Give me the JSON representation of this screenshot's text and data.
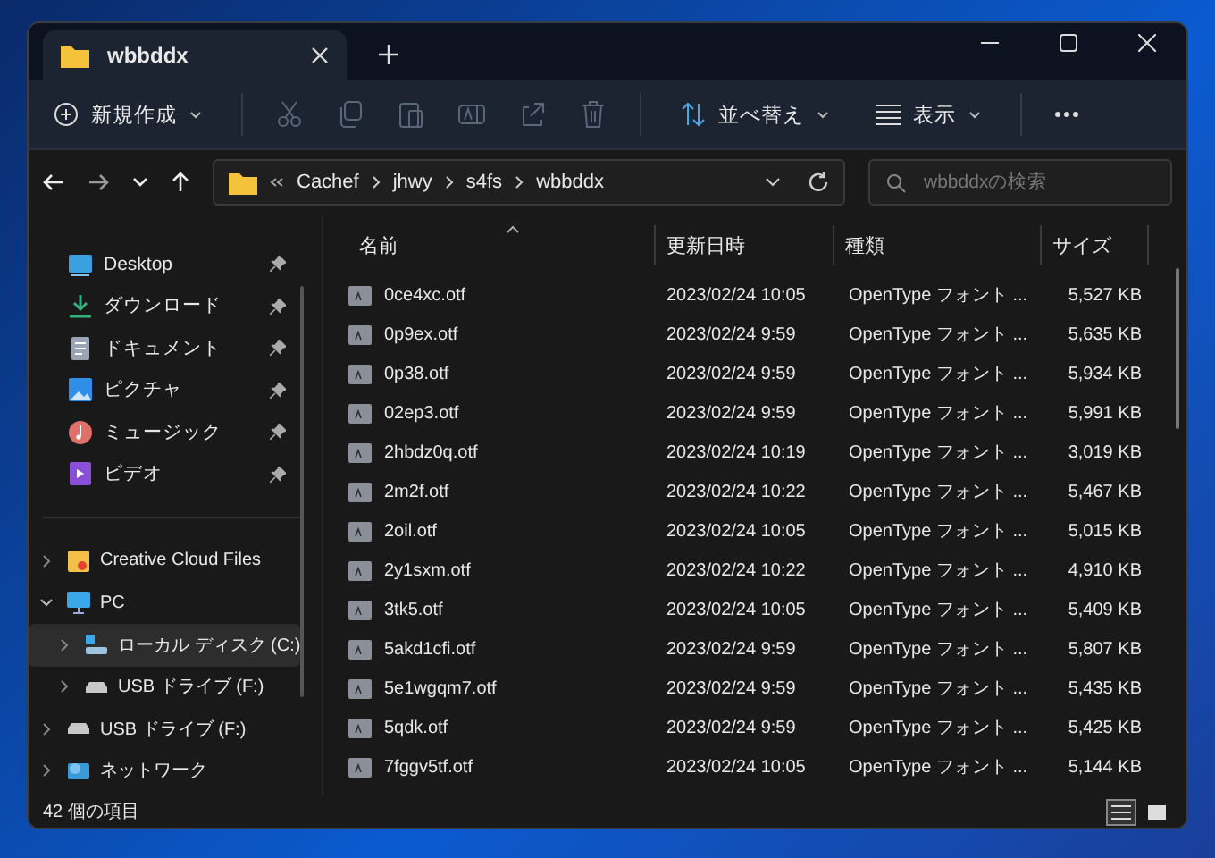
{
  "tab": {
    "title": "wbbddx",
    "selected": true
  },
  "toolbar": {
    "new_label": "新規作成",
    "sort_label": "並べ替え",
    "view_label": "表示"
  },
  "address": {
    "segments": [
      "Cachef",
      "jhwy",
      "s4fs",
      "wbbddx"
    ],
    "search_placeholder": "wbbddxの検索"
  },
  "sidebar": {
    "quick_access": [
      {
        "label": "Desktop",
        "kind": "desktop",
        "pinned": true
      },
      {
        "label": "ダウンロード",
        "kind": "download",
        "pinned": true
      },
      {
        "label": "ドキュメント",
        "kind": "document",
        "pinned": true
      },
      {
        "label": "ピクチャ",
        "kind": "picture",
        "pinned": true
      },
      {
        "label": "ミュージック",
        "kind": "music",
        "pinned": true
      },
      {
        "label": "ビデオ",
        "kind": "video",
        "pinned": true
      }
    ],
    "tree": [
      {
        "label": "Creative Cloud Files",
        "kind": "cloud",
        "expanded": false,
        "selected": false
      },
      {
        "label": "PC",
        "kind": "pc",
        "expanded": true,
        "selected": false,
        "children": [
          {
            "label": "ローカル ディスク (C:)",
            "kind": "disk",
            "expanded": false,
            "selected": true
          },
          {
            "label": "USB ドライブ (F:)",
            "kind": "usb",
            "expanded": false,
            "selected": false
          }
        ]
      },
      {
        "label": "USB ドライブ (F:)",
        "kind": "usb",
        "expanded": false,
        "selected": false
      },
      {
        "label": "ネットワーク",
        "kind": "network",
        "expanded": false,
        "selected": false
      }
    ]
  },
  "table": {
    "columns": [
      {
        "label": "名前",
        "sorted": true
      },
      {
        "label": "更新日時",
        "sorted": false
      },
      {
        "label": "種類",
        "sorted": false
      },
      {
        "label": "サイズ",
        "sorted": false
      }
    ],
    "rows": [
      [
        "0ce4xc.otf",
        "2023/02/24 10:05",
        "OpenType フォント ...",
        "5,527 KB"
      ],
      [
        "0p9ex.otf",
        "2023/02/24 9:59",
        "OpenType フォント ...",
        "5,635 KB"
      ],
      [
        "0p38.otf",
        "2023/02/24 9:59",
        "OpenType フォント ...",
        "5,934 KB"
      ],
      [
        "02ep3.otf",
        "2023/02/24 9:59",
        "OpenType フォント ...",
        "5,991 KB"
      ],
      [
        "2hbdz0q.otf",
        "2023/02/24 10:19",
        "OpenType フォント ...",
        "3,019 KB"
      ],
      [
        "2m2f.otf",
        "2023/02/24 10:22",
        "OpenType フォント ...",
        "5,467 KB"
      ],
      [
        "2oil.otf",
        "2023/02/24 10:05",
        "OpenType フォント ...",
        "5,015 KB"
      ],
      [
        "2y1sxm.otf",
        "2023/02/24 10:22",
        "OpenType フォント ...",
        "4,910 KB"
      ],
      [
        "3tk5.otf",
        "2023/02/24 10:05",
        "OpenType フォント ...",
        "5,409 KB"
      ],
      [
        "5akd1cfi.otf",
        "2023/02/24 9:59",
        "OpenType フォント ...",
        "5,807 KB"
      ],
      [
        "5e1wgqm7.otf",
        "2023/02/24 9:59",
        "OpenType フォント ...",
        "5,435 KB"
      ],
      [
        "5qdk.otf",
        "2023/02/24 9:59",
        "OpenType フォント ...",
        "5,425 KB"
      ],
      [
        "7fggv5tf.otf",
        "2023/02/24 10:05",
        "OpenType フォント ...",
        "5,144 KB"
      ]
    ]
  },
  "status_bar": {
    "count": "42 個の項目",
    "views": [
      {
        "kind": "details",
        "selected": true
      },
      {
        "kind": "tiles",
        "selected": false
      }
    ]
  }
}
